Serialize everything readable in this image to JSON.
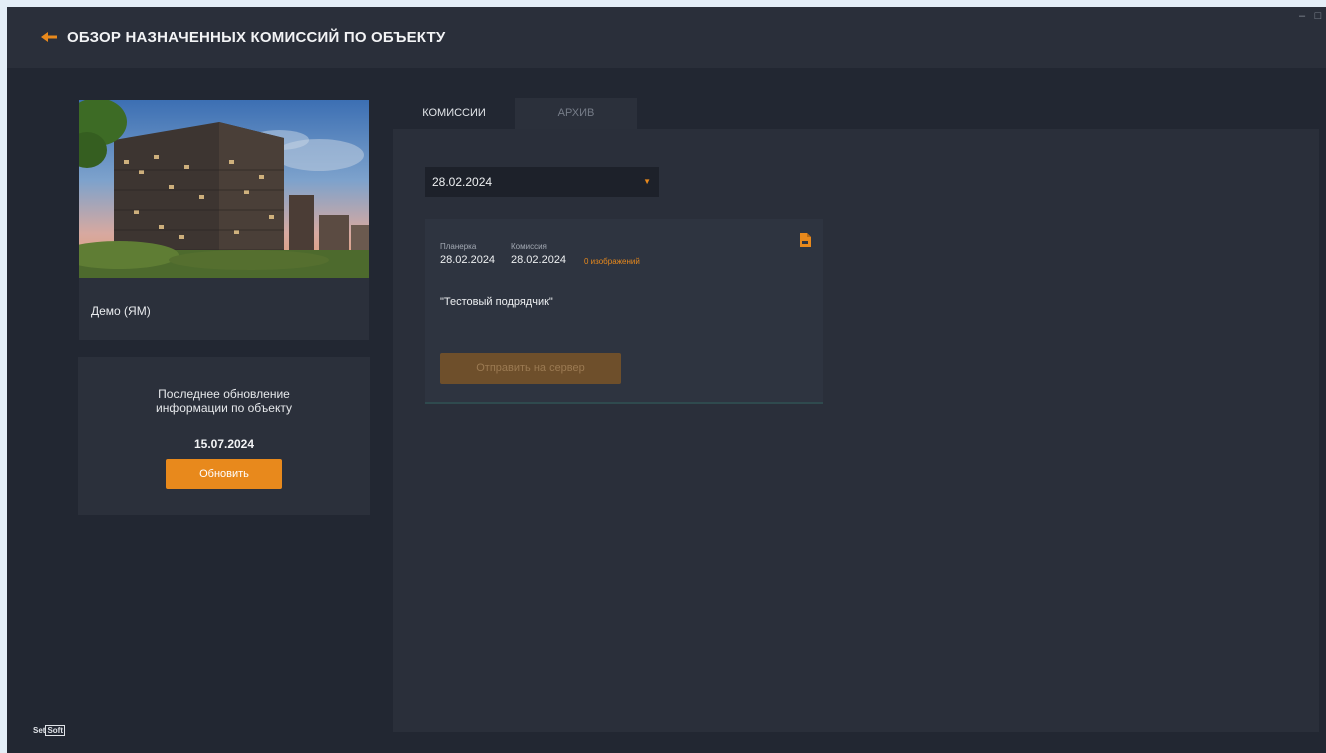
{
  "header": {
    "title": "ОБЗОР НАЗНАЧЕННЫХ КОМИССИЙ ПО ОБЪЕКТУ",
    "back_icon": "arrow-left-icon",
    "window_controls": [
      "–",
      "□"
    ]
  },
  "object": {
    "name": "Демо (ЯМ)"
  },
  "update": {
    "line1": "Последнее обновление",
    "line2": "информации по объекту",
    "date": "15.07.2024",
    "button_label": "Обновить"
  },
  "tabs": [
    {
      "label": "КОМИССИИ",
      "active": true
    },
    {
      "label": "АРХИВ",
      "active": false
    }
  ],
  "date_filter": {
    "selected": "28.02.2024"
  },
  "commission": {
    "planerka_label": "Планерка",
    "planerka_date": "28.02.2024",
    "komissiya_label": "Комиссия",
    "komissiya_date": "28.02.2024",
    "images_label": "0 изображений",
    "contractor": "\"Тестовый подрядчик\"",
    "send_button_label": "Отправить на сервер"
  },
  "brand": {
    "left": "Set",
    "right": "Soft"
  },
  "colors": {
    "accent": "#e8891c",
    "background": "#222732",
    "card": "#2b303b"
  }
}
